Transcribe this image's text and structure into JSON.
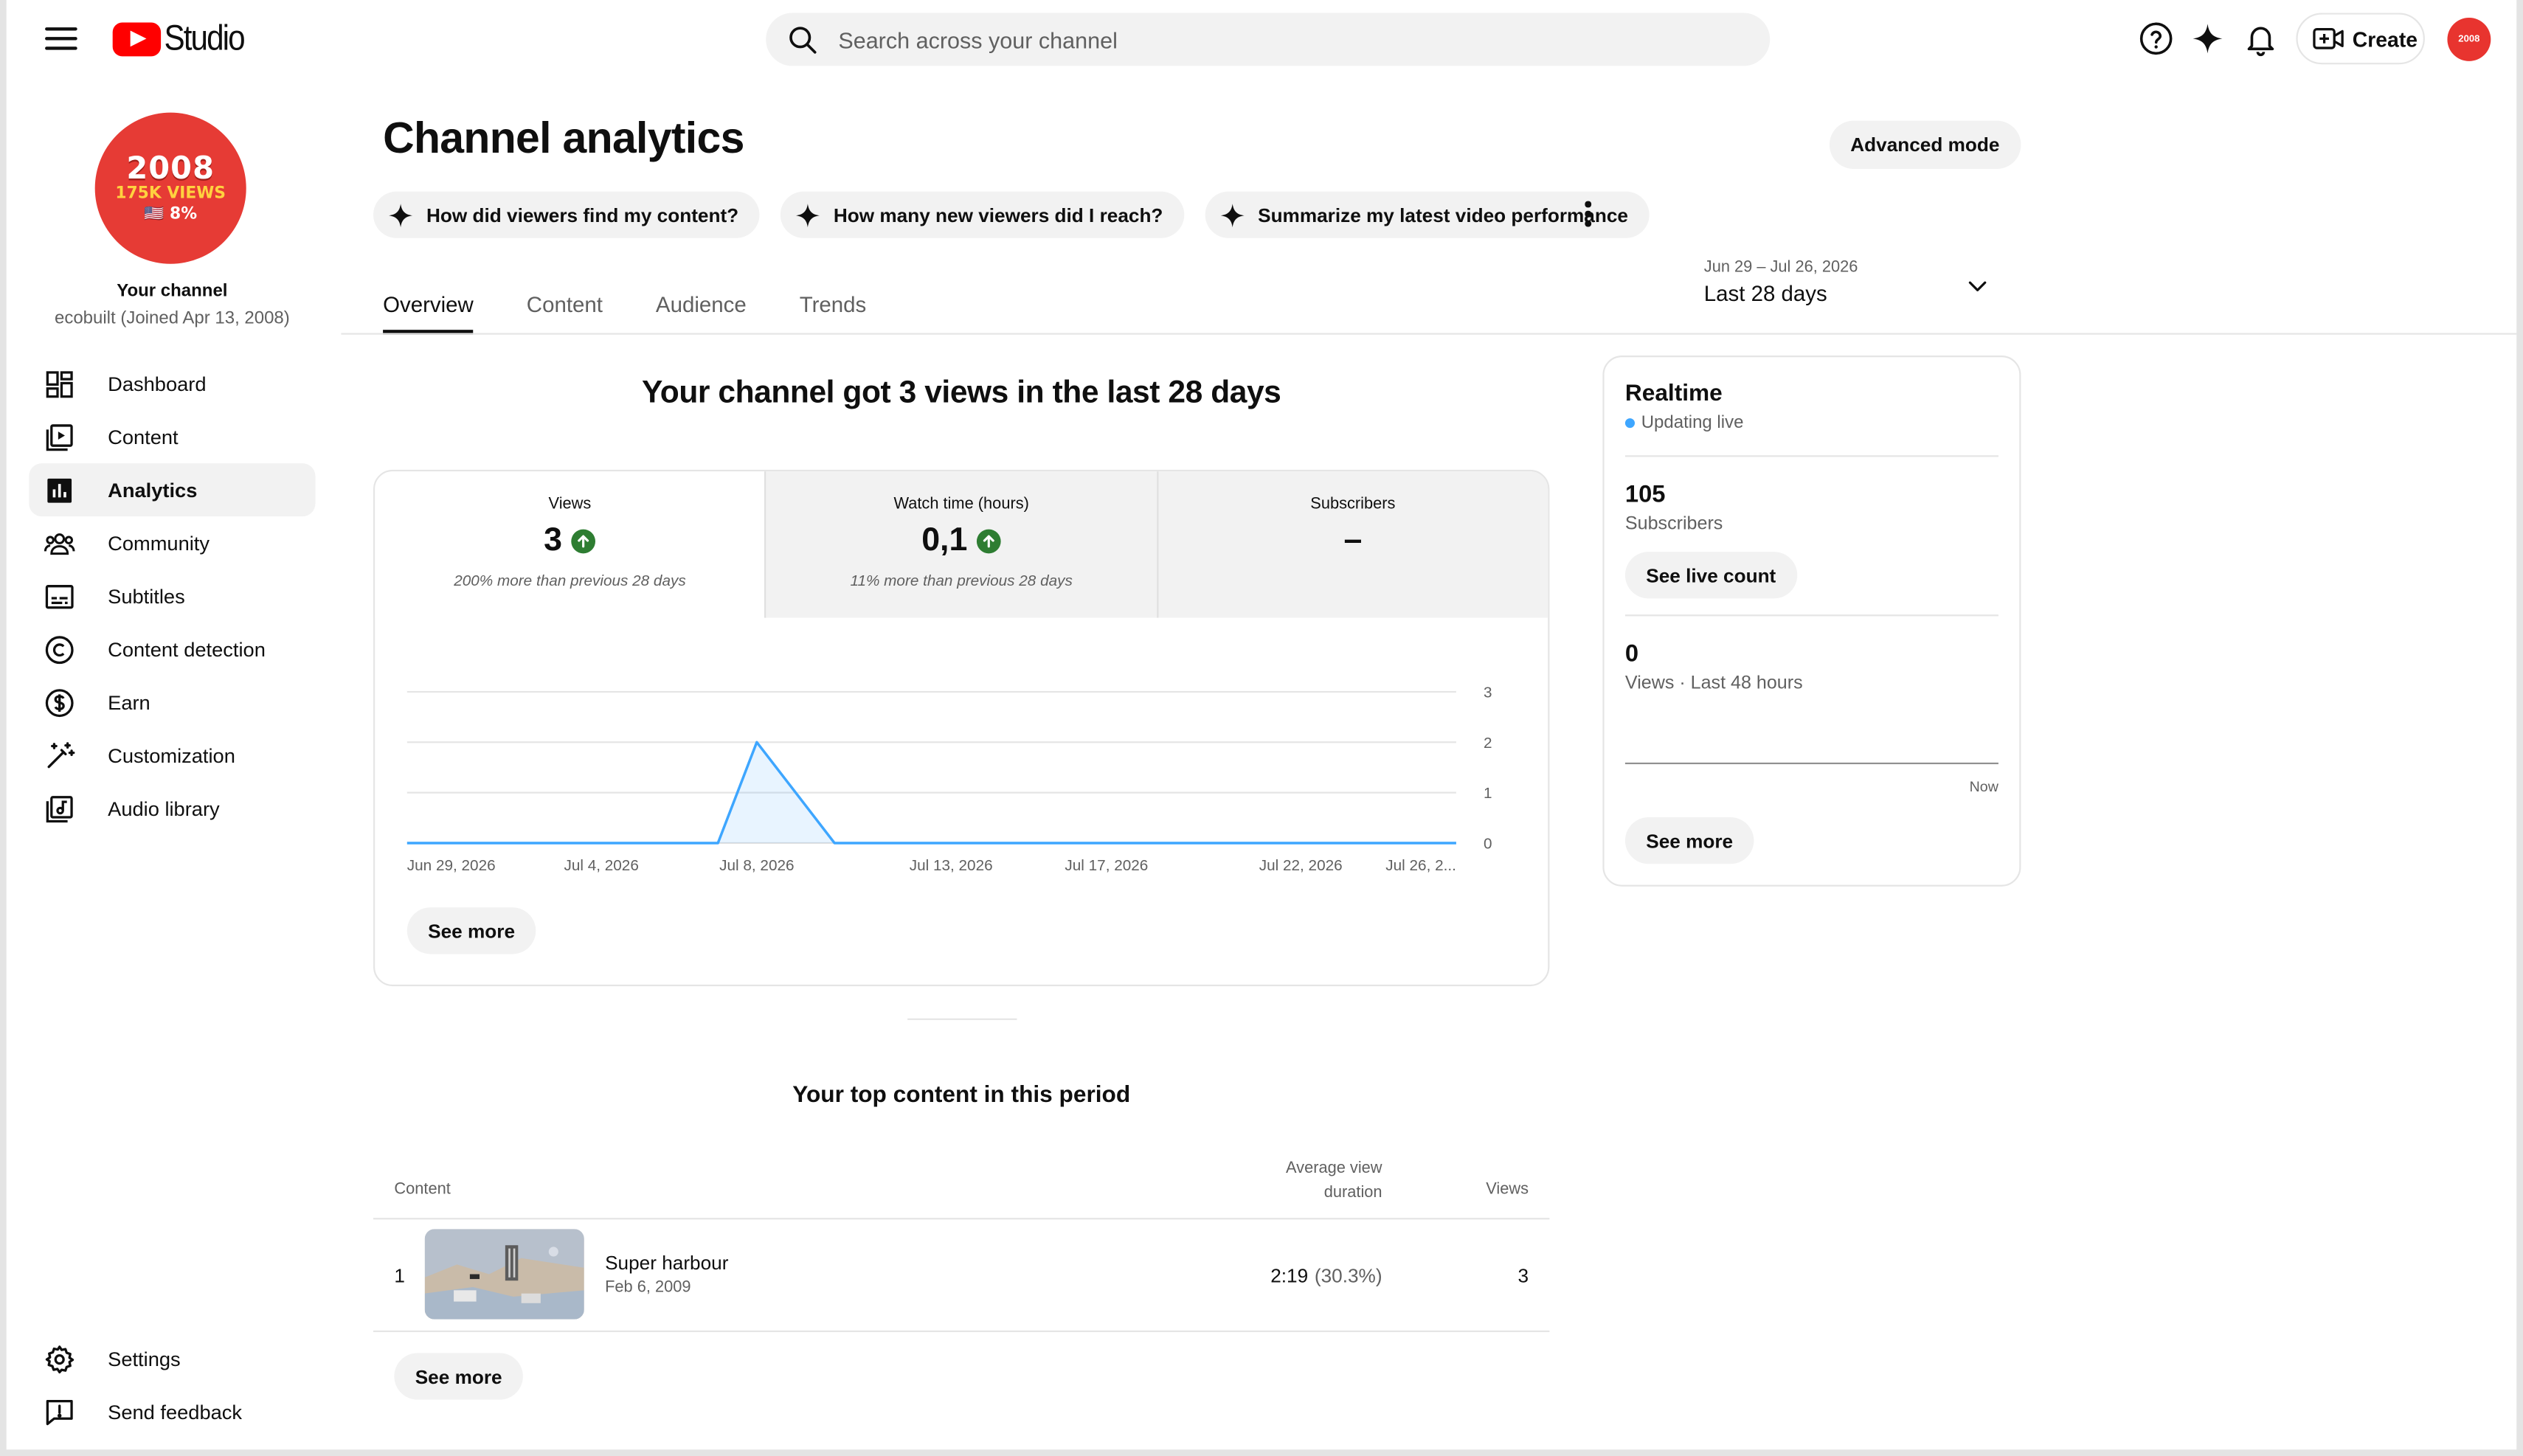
{
  "app": {
    "logo_text": "Studio",
    "search_placeholder": "Search across your channel",
    "create_label": "Create",
    "avatar_text": "2008"
  },
  "channel": {
    "avatar_year": "2008",
    "avatar_views": "175K VIEWS",
    "avatar_pct": "🇺🇸 8%",
    "your_channel_label": "Your channel",
    "subtitle": "ecobuilt (Joined Apr 13, 2008)"
  },
  "sidebar": {
    "items": [
      {
        "label": "Dashboard",
        "icon": "dashboard-icon"
      },
      {
        "label": "Content",
        "icon": "content-icon"
      },
      {
        "label": "Analytics",
        "icon": "analytics-icon",
        "active": true
      },
      {
        "label": "Community",
        "icon": "community-icon"
      },
      {
        "label": "Subtitles",
        "icon": "subtitles-icon"
      },
      {
        "label": "Content detection",
        "icon": "copyright-icon"
      },
      {
        "label": "Earn",
        "icon": "dollar-icon"
      },
      {
        "label": "Customization",
        "icon": "magic-wand-icon"
      },
      {
        "label": "Audio library",
        "icon": "audio-library-icon"
      }
    ],
    "bottom_items": [
      {
        "label": "Settings",
        "icon": "gear-icon"
      },
      {
        "label": "Send feedback",
        "icon": "feedback-icon"
      }
    ]
  },
  "main": {
    "title": "Channel analytics",
    "advanced_mode_label": "Advanced mode",
    "chips": [
      "How did viewers find my content?",
      "How many new viewers did I reach?",
      "Summarize my latest video performance"
    ],
    "tabs": [
      "Overview",
      "Content",
      "Audience",
      "Trends"
    ],
    "active_tab": "Overview",
    "date_range": {
      "dates": "Jun 29 – Jul 26, 2026",
      "label": "Last 28 days"
    },
    "headline": "Your channel got 3 views in the last 28 days",
    "metrics": [
      {
        "label": "Views",
        "value": "3",
        "trend": "up",
        "sub": "200% more than previous 28 days"
      },
      {
        "label": "Watch time (hours)",
        "value": "0,1",
        "trend": "up",
        "sub": "11% more than previous 28 days"
      },
      {
        "label": "Subscribers",
        "value": "–",
        "trend": "",
        "sub": ""
      }
    ],
    "see_more_label": "See more"
  },
  "chart_data": {
    "type": "area",
    "x": [
      "Jun 29, 2026",
      "Jun 30, 2026",
      "Jul 1, 2026",
      "Jul 2, 2026",
      "Jul 3, 2026",
      "Jul 4, 2026",
      "Jul 5, 2026",
      "Jul 6, 2026",
      "Jul 7, 2026",
      "Jul 8, 2026",
      "Jul 9, 2026",
      "Jul 10, 2026",
      "Jul 11, 2026",
      "Jul 12, 2026",
      "Jul 13, 2026",
      "Jul 14, 2026",
      "Jul 15, 2026",
      "Jul 16, 2026",
      "Jul 17, 2026",
      "Jul 18, 2026",
      "Jul 19, 2026",
      "Jul 20, 2026",
      "Jul 21, 2026",
      "Jul 22, 2026",
      "Jul 23, 2026",
      "Jul 24, 2026",
      "Jul 25, 2026",
      "Jul 26, 2026"
    ],
    "values": [
      0,
      0,
      0,
      0,
      0,
      0,
      0,
      0,
      0,
      2,
      1,
      0,
      0,
      0,
      0,
      0,
      0,
      0,
      0,
      0,
      0,
      0,
      0,
      0,
      0,
      0,
      0,
      0
    ],
    "x_tick_labels": [
      "Jun 29, 2026",
      "Jul 4, 2026",
      "Jul 8, 2026",
      "Jul 13, 2026",
      "Jul 17, 2026",
      "Jul 22, 2026",
      "Jul 26, 2..."
    ],
    "x_tick_index": [
      0,
      5,
      9,
      14,
      18,
      23,
      27
    ],
    "y_ticks": [
      0,
      1,
      2,
      3
    ],
    "ylim": [
      0,
      3
    ],
    "grid": true,
    "color": "#3ea6ff"
  },
  "top_content": {
    "title": "Your top content in this period",
    "columns": {
      "content": "Content",
      "avd": "Average view duration",
      "views": "Views"
    },
    "rows": [
      {
        "rank": "1",
        "title": "Super harbour",
        "date": "Feb 6, 2009",
        "avd": "2:19",
        "avd_pct": "(30.3%)",
        "views": "3"
      }
    ],
    "see_more_label": "See more"
  },
  "realtime": {
    "title": "Realtime",
    "status": "Updating live",
    "subscribers_value": "105",
    "subscribers_label": "Subscribers",
    "live_count_label": "See live count",
    "views_value": "0",
    "views_label": "Views · Last 48 hours",
    "now_label": "Now",
    "see_more_label": "See more"
  }
}
